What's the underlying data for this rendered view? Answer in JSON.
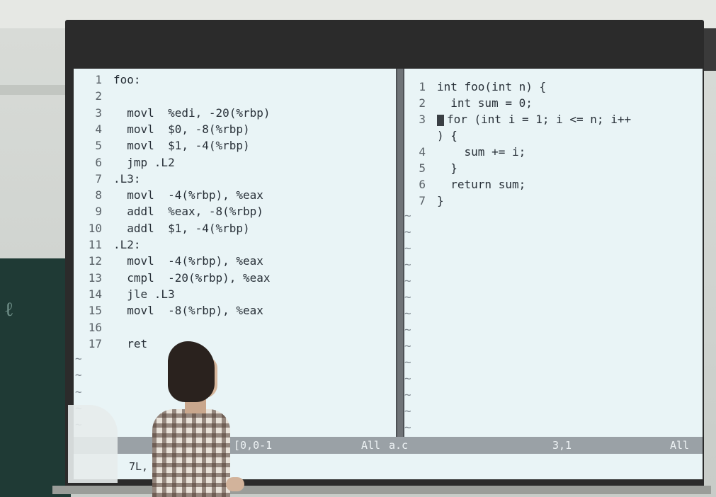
{
  "left_pane": {
    "lines": [
      {
        "num": "1",
        "code": "foo:"
      },
      {
        "num": "2",
        "code": ""
      },
      {
        "num": "3",
        "code": "  movl  %edi, -20(%rbp)"
      },
      {
        "num": "4",
        "code": "  movl  $0, -8(%rbp)"
      },
      {
        "num": "5",
        "code": "  movl  $1, -4(%rbp)"
      },
      {
        "num": "6",
        "code": "  jmp .L2"
      },
      {
        "num": "7",
        "code": ".L3:"
      },
      {
        "num": "8",
        "code": "  movl  -4(%rbp), %eax"
      },
      {
        "num": "9",
        "code": "  addl  %eax, -8(%rbp)"
      },
      {
        "num": "10",
        "code": "  addl  $1, -4(%rbp)"
      },
      {
        "num": "11",
        "code": ".L2:"
      },
      {
        "num": "12",
        "code": "  movl  -4(%rbp), %eax"
      },
      {
        "num": "13",
        "code": "  cmpl  -20(%rbp), %eax"
      },
      {
        "num": "14",
        "code": "  jle .L3"
      },
      {
        "num": "15",
        "code": "  movl  -8(%rbp), %eax"
      },
      {
        "num": "16",
        "code": ""
      },
      {
        "num": "17",
        "code": "  ret"
      }
    ],
    "filler": "~"
  },
  "right_pane": {
    "lines": [
      {
        "num": "1",
        "code": "int foo(int n) {"
      },
      {
        "num": "2",
        "code": "  int sum = 0;"
      },
      {
        "num": "3",
        "code": "for (int i = 1; i <= n; i++"
      },
      {
        "num": "",
        "code": ") {"
      },
      {
        "num": "4",
        "code": "    sum += i;"
      },
      {
        "num": "5",
        "code": "  }"
      },
      {
        "num": "6",
        "code": "  return sum;"
      },
      {
        "num": "7",
        "code": "}"
      }
    ],
    "filler": "~"
  },
  "statusbar": {
    "left_position": "[0,0-1",
    "left_scroll": "All",
    "right_filename": "a.c",
    "right_position": "3,1",
    "right_scroll": "All"
  },
  "command_line": "7L,"
}
